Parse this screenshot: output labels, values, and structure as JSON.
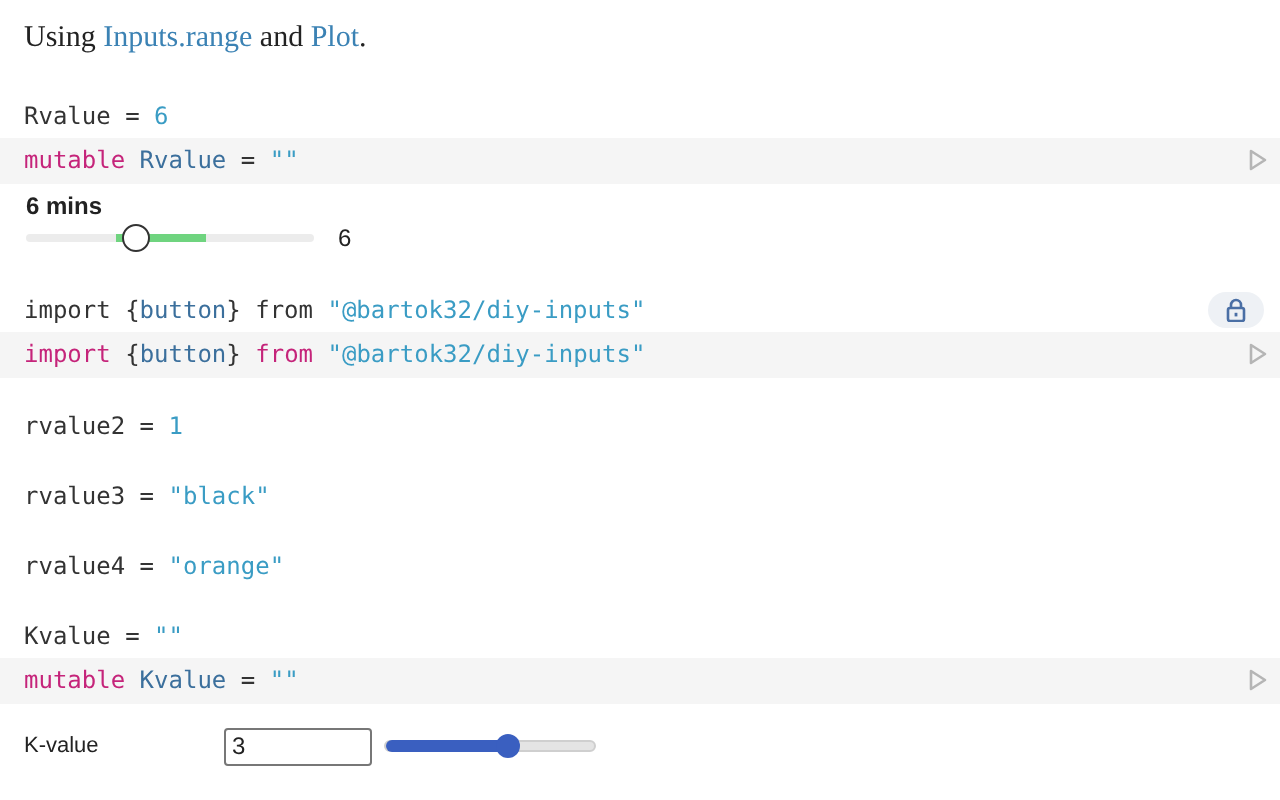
{
  "cells": [
    {
      "kind": "prose",
      "parts": [
        {
          "kind": "text",
          "text": "Using "
        },
        {
          "kind": "link",
          "text": "Inputs.range"
        },
        {
          "kind": "text",
          "text": " and "
        },
        {
          "kind": "link",
          "text": "Plot"
        },
        {
          "kind": "text",
          "text": "."
        }
      ]
    },
    {
      "kind": "output",
      "locked": false,
      "tokens": [
        {
          "kind": "plain",
          "text": "Rvalue = "
        },
        {
          "kind": "literal",
          "text": "6"
        }
      ]
    },
    {
      "kind": "code",
      "tokens": [
        {
          "kind": "keyword",
          "text": "mutable"
        },
        {
          "kind": "name",
          "text": " Rvalue"
        },
        {
          "kind": "plain",
          "text": " = "
        },
        {
          "kind": "literal",
          "text": "\"\""
        }
      ]
    },
    {
      "kind": "time_slider",
      "label": "6 mins",
      "level": 0.38,
      "reading": "6"
    },
    {
      "kind": "output",
      "locked": true,
      "tokens": [
        {
          "kind": "plain",
          "text": "import {"
        },
        {
          "kind": "name",
          "text": "button"
        },
        {
          "kind": "plain",
          "text": "} from "
        },
        {
          "kind": "literal",
          "text": "\"@bartok32/diy-inputs\""
        }
      ]
    },
    {
      "kind": "code",
      "tokens": [
        {
          "kind": "keyword",
          "text": "import"
        },
        {
          "kind": "plain",
          "text": " {"
        },
        {
          "kind": "name",
          "text": "button"
        },
        {
          "kind": "plain",
          "text": "} "
        },
        {
          "kind": "keyword",
          "text": "from"
        },
        {
          "kind": "literal",
          "text": " \"@bartok32/diy-inputs\""
        }
      ]
    },
    {
      "kind": "output",
      "locked": false,
      "tokens": [
        {
          "kind": "plain",
          "text": "rvalue2 = "
        },
        {
          "kind": "literal",
          "text": "1"
        }
      ]
    },
    {
      "kind": "output",
      "locked": false,
      "tokens": [
        {
          "kind": "plain",
          "text": "rvalue3 = "
        },
        {
          "kind": "literal",
          "text": "\"black\""
        }
      ]
    },
    {
      "kind": "output",
      "locked": false,
      "tokens": [
        {
          "kind": "plain",
          "text": "rvalue4 = "
        },
        {
          "kind": "literal",
          "text": "\"orange\""
        }
      ]
    },
    {
      "kind": "output",
      "locked": false,
      "tokens": [
        {
          "kind": "plain",
          "text": "Kvalue = "
        },
        {
          "kind": "literal",
          "text": "\"\""
        }
      ]
    },
    {
      "kind": "code",
      "tokens": [
        {
          "kind": "keyword",
          "text": "mutable"
        },
        {
          "kind": "name",
          "text": " Kvalue"
        },
        {
          "kind": "plain",
          "text": " = "
        },
        {
          "kind": "literal",
          "text": "\"\""
        }
      ]
    },
    {
      "kind": "range_input",
      "label": "K-value",
      "value": "3",
      "level": 0.59
    }
  ]
}
